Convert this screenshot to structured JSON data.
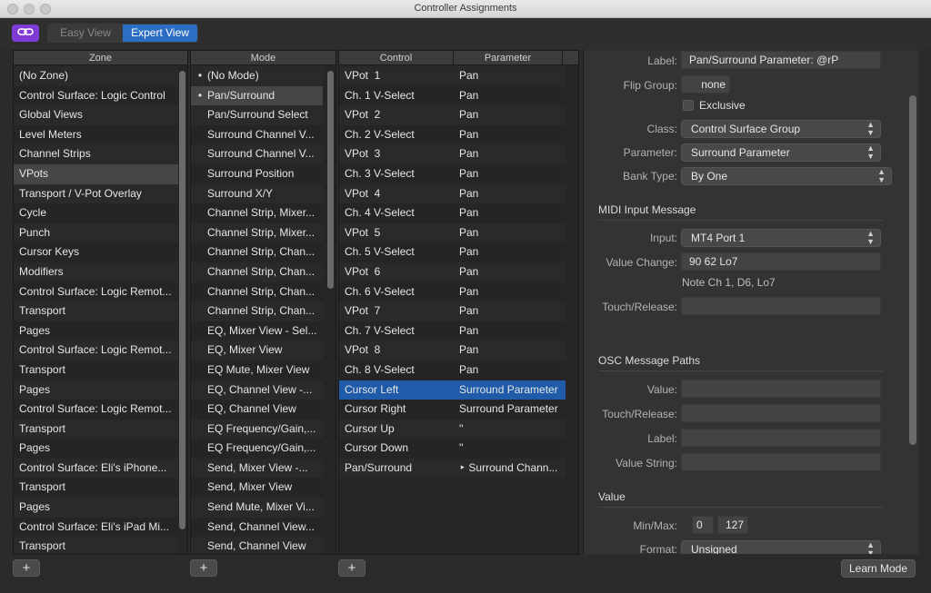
{
  "window": {
    "title": "Controller Assignments"
  },
  "toolbar": {
    "link_icon": "link-icon",
    "views": [
      {
        "label": "Easy View",
        "selected": false
      },
      {
        "label": "Expert View",
        "selected": true
      }
    ]
  },
  "zone": {
    "header": "Zone",
    "items": [
      "(No Zone)",
      "Control Surface: Logic Control",
      "Global Views",
      "Level Meters",
      "Channel Strips",
      "VPots",
      "Transport / V-Pot Overlay",
      "Cycle",
      "Punch",
      "Cursor Keys",
      "Modifiers",
      "Control Surface: Logic Remot...",
      "Transport",
      "Pages",
      "Control Surface: Logic Remot...",
      "Transport",
      "Pages",
      "Control Surface: Logic Remot...",
      "Transport",
      "Pages",
      "Control Surface: Eli's iPhone...",
      "Transport",
      "Pages",
      "Control Surface: Eli's iPad Mi...",
      "Transport"
    ],
    "selected_index": 5
  },
  "mode": {
    "header": "Mode",
    "items": [
      "(No Mode)",
      "Pan/Surround",
      "Pan/Surround Select",
      "Surround Channel V...",
      "Surround Channel V...",
      "Surround Position",
      "Surround X/Y",
      "Channel Strip, Mixer...",
      "Channel Strip, Mixer...",
      "Channel Strip, Chan...",
      "Channel Strip, Chan...",
      "Channel Strip, Chan...",
      "Channel Strip, Chan...",
      "EQ, Mixer View - Sel...",
      "EQ, Mixer View",
      "EQ Mute, Mixer View",
      "EQ, Channel View -...",
      "EQ, Channel View",
      "EQ Frequency/Gain,...",
      "EQ Frequency/Gain,...",
      "Send, Mixer View -...",
      "Send, Mixer View",
      "Send Mute, Mixer Vi...",
      "Send, Channel View...",
      "Send, Channel View"
    ],
    "bullets": [
      0,
      1
    ],
    "selected_index": 1
  },
  "control": {
    "header_control": "Control",
    "header_parameter": "Parameter",
    "rows": [
      {
        "control": "VPot  1",
        "parameter": "Pan"
      },
      {
        "control": "Ch. 1 V-Select",
        "parameter": "Pan"
      },
      {
        "control": "VPot  2",
        "parameter": "Pan"
      },
      {
        "control": "Ch. 2 V-Select",
        "parameter": "Pan"
      },
      {
        "control": "VPot  3",
        "parameter": "Pan"
      },
      {
        "control": "Ch. 3 V-Select",
        "parameter": "Pan"
      },
      {
        "control": "VPot  4",
        "parameter": "Pan"
      },
      {
        "control": "Ch. 4 V-Select",
        "parameter": "Pan"
      },
      {
        "control": "VPot  5",
        "parameter": "Pan"
      },
      {
        "control": "Ch. 5 V-Select",
        "parameter": "Pan"
      },
      {
        "control": "VPot  6",
        "parameter": "Pan"
      },
      {
        "control": "Ch. 6 V-Select",
        "parameter": "Pan"
      },
      {
        "control": "VPot  7",
        "parameter": "Pan"
      },
      {
        "control": "Ch. 7 V-Select",
        "parameter": "Pan"
      },
      {
        "control": "VPot  8",
        "parameter": "Pan"
      },
      {
        "control": "Ch. 8 V-Select",
        "parameter": "Pan"
      },
      {
        "control": "Cursor Left",
        "parameter": "Surround Parameter"
      },
      {
        "control": "Cursor Right",
        "parameter": "Surround Parameter"
      },
      {
        "control": "Cursor Up",
        "parameter": "''"
      },
      {
        "control": "Cursor Down",
        "parameter": "''"
      },
      {
        "control": "Pan/Surround",
        "parameter": "‣ Surround Chann..."
      }
    ],
    "selected_index": 16
  },
  "inspector": {
    "label": {
      "label": "Label:",
      "value": "Pan/Surround Parameter: @rP"
    },
    "flip_group": {
      "label": "Flip Group:",
      "value": "none"
    },
    "exclusive": {
      "label": "Exclusive",
      "checked": false
    },
    "class": {
      "label": "Class:",
      "value": "Control Surface Group"
    },
    "parameter": {
      "label": "Parameter:",
      "value": "Surround Parameter"
    },
    "bank_type": {
      "label": "Bank Type:",
      "value": "By One"
    },
    "midi_section": "MIDI Input Message",
    "input": {
      "label": "Input:",
      "value": "MT4 Port 1"
    },
    "value_change": {
      "label": "Value Change:",
      "value": "90 62 Lo7",
      "note": "Note Ch 1, D6, Lo7"
    },
    "touch_release": {
      "label": "Touch/Release:",
      "value": ""
    },
    "osc_section": "OSC Message Paths",
    "osc_value": {
      "label": "Value:",
      "value": ""
    },
    "osc_touch": {
      "label": "Touch/Release:",
      "value": ""
    },
    "osc_label": {
      "label": "Label:",
      "value": ""
    },
    "osc_value_string": {
      "label": "Value String:",
      "value": ""
    },
    "value_section": "Value",
    "minmax": {
      "label": "Min/Max:",
      "min": "0",
      "max": "127"
    },
    "format": {
      "label": "Format:",
      "value": "Unsigned"
    }
  },
  "buttons": {
    "add": "+",
    "learn_mode": "Learn Mode"
  },
  "colors": {
    "accent_blue": "#1f5ba8",
    "link_purple": "#7e3bd6"
  }
}
